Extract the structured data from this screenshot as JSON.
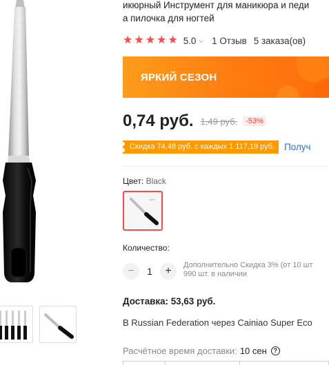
{
  "product": {
    "title_line1": "икюрный Инструмент для маникюра и педи",
    "title_line2": "а пилочка для ногтей"
  },
  "rating": {
    "value": "5.0",
    "stars": 5,
    "reviews": "1 Отзыв",
    "orders": "5 заказа(ов)"
  },
  "banner": {
    "text": "ЯРКИЙ СЕЗОН"
  },
  "price": {
    "current": "0,74 руб.",
    "old": "1,49 руб.",
    "discount": "-53%"
  },
  "coupon": {
    "text": "Скидка 74,48 руб. с каждых 1 117,19 руб.",
    "link": "Получ"
  },
  "color": {
    "label": "Цвет:",
    "value": "Black",
    "swatch_caption": "1pcs"
  },
  "quantity": {
    "label": "Количество:",
    "minus": "−",
    "value": "1",
    "plus": "+",
    "note_line1": "Дополнительно Скидка 3% (от 10 шт",
    "note_line2": "990 шт. в наличии"
  },
  "delivery": {
    "title": "Доставка: 53,63 руб.",
    "description": "В Russian Federation через Cainiao Super Eco",
    "eta_label": "Расчётное время доставки:",
    "eta_value": "10 сен",
    "help": "?"
  },
  "colors": {
    "accent": "#ff4747",
    "banner_orange": "#ff7b10",
    "coupon_orange": "#ff9900",
    "link_blue": "#1a73e8"
  },
  "icons": [
    "star-icon",
    "chevron-down-icon",
    "minus-icon",
    "plus-icon",
    "help-icon"
  ]
}
